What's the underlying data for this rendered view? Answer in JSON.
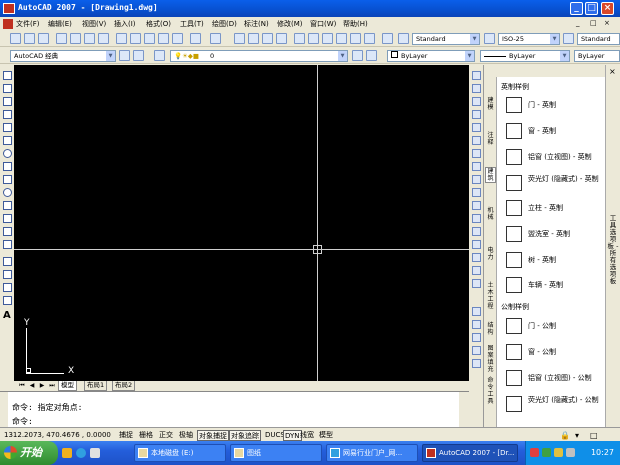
{
  "window": {
    "title": "AutoCAD 2007 - [Drawing1.dwg]",
    "min": "_",
    "max": "□",
    "close": "×"
  },
  "menu": [
    "文件(F)",
    "编辑(E)",
    "视图(V)",
    "插入(I)",
    "格式(O)",
    "工具(T)",
    "绘图(D)",
    "标注(N)",
    "修改(M)",
    "窗口(W)",
    "帮助(H)"
  ],
  "menu_right": {
    "min": "_",
    "restore": "□",
    "close": "×"
  },
  "toolbar": {
    "text_style": "Standard",
    "dim_style": "ISO-25",
    "table_style": "Standard",
    "workspace": "AutoCAD 经典",
    "layer": "0",
    "color": "ByLayer",
    "linetype": "ByLayer",
    "lineweight": "ByLayer"
  },
  "layout_tabs": [
    "模型",
    "布局1",
    "布局2"
  ],
  "ucs": {
    "x": "X",
    "y": "Y"
  },
  "command": {
    "line1": "命令: 指定对角点:",
    "line2": "命令:"
  },
  "status": {
    "coords": "1312.2073, 470.4676 , 0.0000",
    "toggles": [
      "捕捉",
      "栅格",
      "正交",
      "极轴",
      "对象捕捉",
      "对象追踪",
      "DUCS",
      "DYN",
      "线宽",
      "模型"
    ]
  },
  "palette": {
    "title": "工具选项板 - 所有选项板",
    "tabs": [
      "建模",
      "注释",
      "建筑",
      "机械",
      "电力",
      "土木工程",
      "结构",
      "图案填充",
      "命令工具"
    ],
    "section1": "英制样例",
    "items1": [
      "门 - 英制",
      "窗 - 英制",
      "铝窗 (立视图) - 英制",
      "荧光灯 (隐藏式) - 英制",
      "立柱 - 英制",
      "盥洗室 - 英制",
      "树 - 英制",
      "车辆 - 英制"
    ],
    "section2": "公制样例",
    "items2": [
      "门 - 公制",
      "窗 - 公制",
      "铝窗 (立视图) - 公制",
      "荧光灯 (隐藏式) - 公制"
    ]
  },
  "taskbar": {
    "start": "开始",
    "tasks": [
      "本地磁盘 (E:)",
      "图纸",
      "网易行业门户_网...",
      "AutoCAD 2007 - [Dr..."
    ],
    "clock": "10:27"
  },
  "colors": {
    "canvas": "#000000",
    "title": "#0A5FEA",
    "taskbar": "#245EDB"
  }
}
